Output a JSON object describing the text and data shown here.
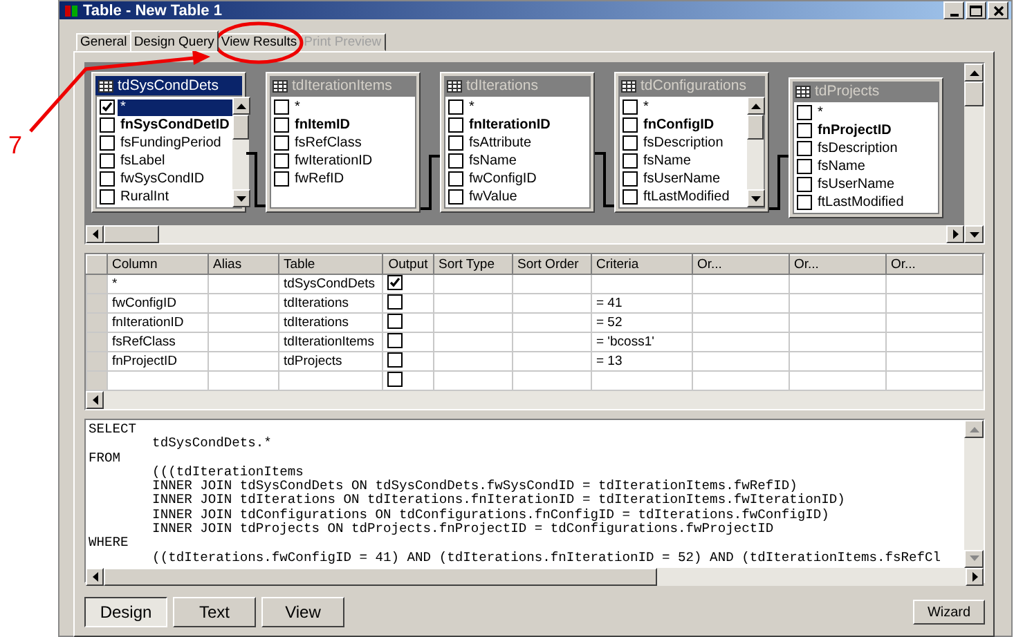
{
  "window": {
    "title": "Table - New Table 1"
  },
  "annotation": {
    "label": "7"
  },
  "tabs": [
    {
      "label": "General",
      "selected": false,
      "disabled": false
    },
    {
      "label": "Design Query",
      "selected": true,
      "disabled": false
    },
    {
      "label": "View Results",
      "selected": false,
      "disabled": false
    },
    {
      "label": "Print Preview",
      "selected": false,
      "disabled": true
    }
  ],
  "diagram": {
    "tables": [
      {
        "name": "tdSysCondDets",
        "active": true,
        "scrollbar": true,
        "fields": [
          {
            "name": "*",
            "checked": true,
            "selected": true,
            "key": false
          },
          {
            "name": "fnSysCondDetID",
            "checked": false,
            "selected": false,
            "key": true
          },
          {
            "name": "fsFundingPeriod",
            "checked": false,
            "selected": false,
            "key": false
          },
          {
            "name": "fsLabel",
            "checked": false,
            "selected": false,
            "key": false
          },
          {
            "name": "fwSysCondID",
            "checked": false,
            "selected": false,
            "key": false
          },
          {
            "name": "RuralInt",
            "checked": false,
            "selected": false,
            "key": false
          }
        ]
      },
      {
        "name": "tdIterationItems",
        "active": false,
        "scrollbar": false,
        "fields": [
          {
            "name": "*",
            "checked": false,
            "selected": false,
            "key": false
          },
          {
            "name": "fnItemID",
            "checked": false,
            "selected": false,
            "key": true
          },
          {
            "name": "fsRefClass",
            "checked": false,
            "selected": false,
            "key": false
          },
          {
            "name": "fwIterationID",
            "checked": false,
            "selected": false,
            "key": false
          },
          {
            "name": "fwRefID",
            "checked": false,
            "selected": false,
            "key": false
          }
        ]
      },
      {
        "name": "tdIterations",
        "active": false,
        "scrollbar": false,
        "fields": [
          {
            "name": "*",
            "checked": false,
            "selected": false,
            "key": false
          },
          {
            "name": "fnIterationID",
            "checked": false,
            "selected": false,
            "key": true
          },
          {
            "name": "fsAttribute",
            "checked": false,
            "selected": false,
            "key": false
          },
          {
            "name": "fsName",
            "checked": false,
            "selected": false,
            "key": false
          },
          {
            "name": "fwConfigID",
            "checked": false,
            "selected": false,
            "key": false
          },
          {
            "name": "fwValue",
            "checked": false,
            "selected": false,
            "key": false
          }
        ]
      },
      {
        "name": "tdConfigurations",
        "active": false,
        "scrollbar": true,
        "fields": [
          {
            "name": "*",
            "checked": false,
            "selected": false,
            "key": false
          },
          {
            "name": "fnConfigID",
            "checked": false,
            "selected": false,
            "key": true
          },
          {
            "name": "fsDescription",
            "checked": false,
            "selected": false,
            "key": false
          },
          {
            "name": "fsName",
            "checked": false,
            "selected": false,
            "key": false
          },
          {
            "name": "fsUserName",
            "checked": false,
            "selected": false,
            "key": false
          },
          {
            "name": "ftLastModified",
            "checked": false,
            "selected": false,
            "key": false
          }
        ]
      },
      {
        "name": "tdProjects",
        "active": false,
        "scrollbar": false,
        "fields": [
          {
            "name": "*",
            "checked": false,
            "selected": false,
            "key": false
          },
          {
            "name": "fnProjectID",
            "checked": false,
            "selected": false,
            "key": true
          },
          {
            "name": "fsDescription",
            "checked": false,
            "selected": false,
            "key": false
          },
          {
            "name": "fsName",
            "checked": false,
            "selected": false,
            "key": false
          },
          {
            "name": "fsUserName",
            "checked": false,
            "selected": false,
            "key": false
          },
          {
            "name": "ftLastModified",
            "checked": false,
            "selected": false,
            "key": false
          }
        ]
      }
    ]
  },
  "grid": {
    "columns": [
      "Column",
      "Alias",
      "Table",
      "Output",
      "Sort Type",
      "Sort Order",
      "Criteria",
      "Or...",
      "Or...",
      "Or..."
    ],
    "rows": [
      {
        "column": "*",
        "table": "tdSysCondDets",
        "output": true
      },
      {
        "column": "fwConfigID",
        "table": "tdIterations",
        "output": false,
        "criteria": "= 41"
      },
      {
        "column": "fnIterationID",
        "table": "tdIterations",
        "output": false,
        "criteria": "= 52"
      },
      {
        "column": "fsRefClass",
        "table": "tdIterationItems",
        "output": false,
        "criteria": "= 'bcoss1'"
      },
      {
        "column": "fnProjectID",
        "table": "tdProjects",
        "output": false,
        "criteria": "= 13"
      },
      {
        "output": false
      }
    ]
  },
  "sql": {
    "lines": [
      "SELECT",
      "        tdSysCondDets.*",
      "FROM",
      "        (((tdIterationItems",
      "        INNER JOIN tdSysCondDets ON tdSysCondDets.fwSysCondID = tdIterationItems.fwRefID)",
      "        INNER JOIN tdIterations ON tdIterations.fnIterationID = tdIterationItems.fwIterationID)",
      "        INNER JOIN tdConfigurations ON tdConfigurations.fnConfigID = tdIterations.fwConfigID)",
      "        INNER JOIN tdProjects ON tdProjects.fnProjectID = tdConfigurations.fwProjectID",
      "WHERE",
      "        ((tdIterations.fwConfigID = 41) AND (tdIterations.fnIterationID = 52) AND (tdIterationItems.fsRefCl"
    ]
  },
  "view_buttons": [
    {
      "label": "Design",
      "selected": true
    },
    {
      "label": "Text",
      "selected": false
    },
    {
      "label": "View",
      "selected": false
    }
  ],
  "wizard_button": {
    "label": "Wizard"
  }
}
